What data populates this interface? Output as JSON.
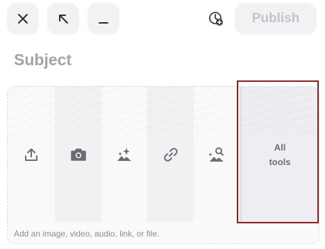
{
  "toolbar": {
    "close_icon": "close-icon",
    "collapse_icon": "arrow-up-left-icon",
    "minimize_icon": "minimize-icon",
    "schedule_icon": "clock-plus-icon",
    "publish_label": "Publish",
    "publish_disabled": true
  },
  "editor": {
    "subject_placeholder": "Subject"
  },
  "media": {
    "tools": [
      {
        "name": "upload",
        "icon": "upload-icon"
      },
      {
        "name": "camera",
        "icon": "camera-icon"
      },
      {
        "name": "ai-image",
        "icon": "sparkle-image-icon"
      },
      {
        "name": "link",
        "icon": "link-icon"
      },
      {
        "name": "image-search",
        "icon": "image-search-icon"
      }
    ],
    "all_tools_line1": "All",
    "all_tools_line2": "tools",
    "hint": "Add an image, video, audio, link, or file."
  },
  "colors": {
    "button_bg": "#f2f2f4",
    "icon": "#6b6b72",
    "highlight": "#8b1a1a"
  }
}
